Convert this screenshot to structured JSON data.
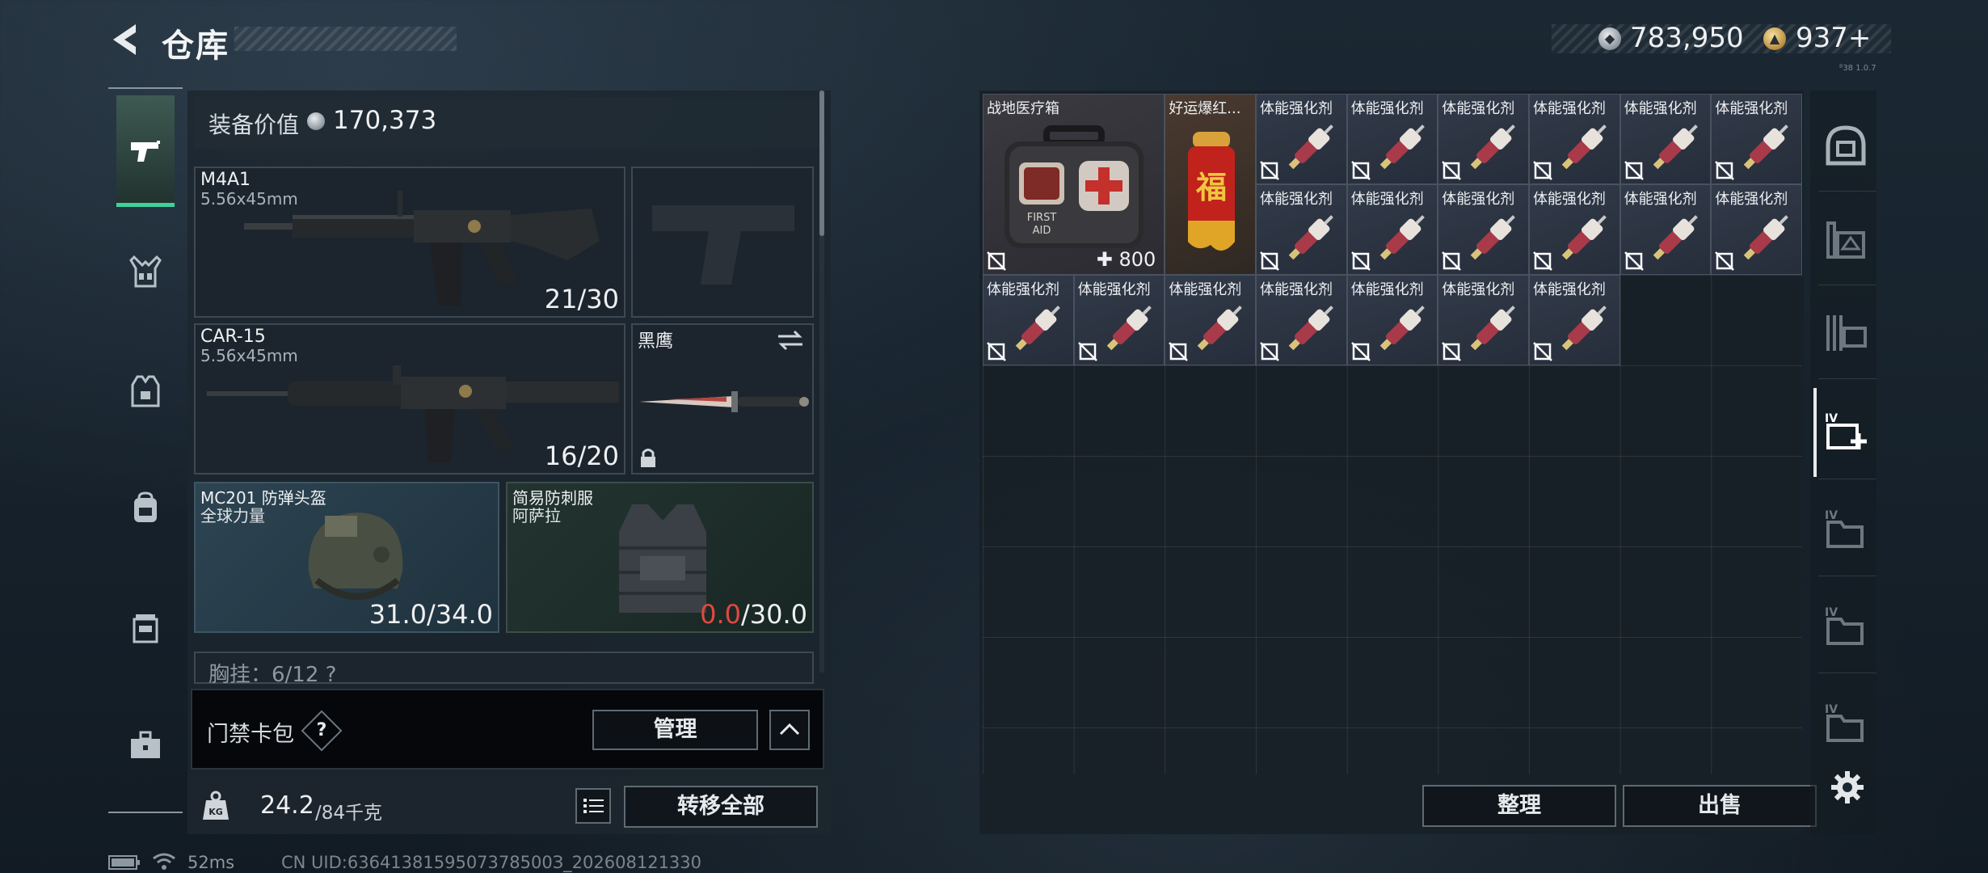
{
  "header": {
    "title": "仓库",
    "silver_value": "783,950",
    "gold_value": "937+",
    "version": "ᴮ38 1.0.7"
  },
  "loadout": {
    "equip_value_label": "装备价值",
    "equip_value": "170,373",
    "primary_1": {
      "name": "M4A1",
      "caliber": "5.56x45mm",
      "ammo": "21/30"
    },
    "primary_2": {
      "name": "CAR-15",
      "caliber": "5.56x45mm",
      "ammo": "16/20"
    },
    "melee": {
      "name": "黑鹰"
    },
    "helmet": {
      "name": "MC201 防弹头盔",
      "maker": "全球力量",
      "durability": "31.0/34.0"
    },
    "armor": {
      "name": "简易防刺服",
      "maker": "阿萨拉",
      "durability_current": "0.0",
      "durability_max": "/30.0"
    },
    "chest_rig_label": "胸挂：6/12  ?",
    "keycard_label": "门禁卡包",
    "keycard_help": "?",
    "manage_label": "管理",
    "weight_current": "24.2",
    "weight_max": "/84千克",
    "transfer_all_label": "转移全部"
  },
  "storage": {
    "medkit": {
      "name": "战地医疗箱",
      "capacity": "800"
    },
    "firecracker": {
      "name": "好运爆红..."
    },
    "stim_name": "体能强化剂",
    "sort_label": "整理",
    "sell_label": "出售"
  },
  "footer": {
    "ping": "52ms",
    "uid": "CN UID:6364138159507378500З_202608121330"
  },
  "colors": {
    "accent_green": "#3fd19c",
    "armor_broken_red": "#e2483f"
  },
  "icons": {
    "left_rail": [
      "pistol-icon",
      "chest-rig-icon",
      "armor-vest-icon",
      "backpack-icon",
      "pouch-icon",
      "briefcase-icon"
    ],
    "right_rail": [
      "safe-box-icon",
      "storage-ext-icon",
      "storage-rack-icon",
      "medical-storage-icon",
      "storage-folder-icon",
      "storage-folder-icon",
      "storage-folder-icon"
    ]
  }
}
